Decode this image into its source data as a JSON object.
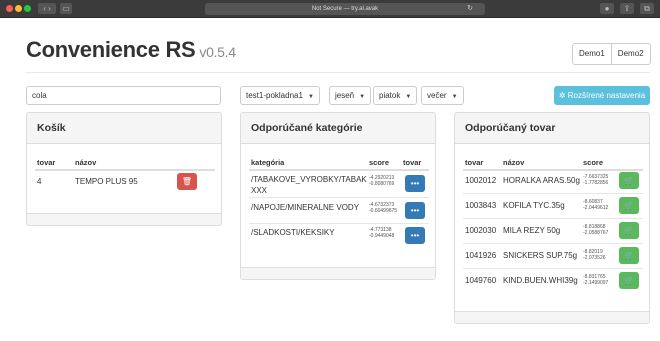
{
  "browser": {
    "url_text": "Not Secure — try.al.avak"
  },
  "app": {
    "title": "Convenience RS",
    "version": "v0.5.4"
  },
  "demo_buttons": [
    "Demo1",
    "Demo2"
  ],
  "search": {
    "value": "cola"
  },
  "filters": [
    {
      "label": "test1-pokladna1"
    },
    {
      "label": "jeseň"
    },
    {
      "label": "piatok"
    },
    {
      "label": "večer"
    }
  ],
  "advanced_button": "Rozšírené nastavenia",
  "kosik": {
    "title": "Košík",
    "columns": [
      "tovar",
      "názov"
    ],
    "rows": [
      {
        "tovar": "4",
        "nazov": "TEMPO PLUS 95"
      }
    ]
  },
  "categories": {
    "title": "Odporúčané kategórie",
    "columns": [
      "kategória",
      "score",
      "tovar"
    ],
    "rows": [
      {
        "name_line1": "/TABAKOVE_VYROBKY/TABAK",
        "name_line2": "XXX",
        "score1": "-4.2920213",
        "score2": "-0.8080769",
        "button": "•••"
      },
      {
        "name_line1": "/NAPOJE/MINERALNE VODY",
        "name_line2": "",
        "score1": "-4.6732373",
        "score2": "-0.60499675",
        "button": "•••"
      },
      {
        "name_line1": "/SLADKOSTI/KEKSIKY",
        "name_line2": "",
        "score1": "-4.773138",
        "score2": "-0.9449048",
        "button": "•••"
      }
    ]
  },
  "products": {
    "title": "Odporúčaný tovar",
    "columns": [
      "tovar",
      "názov",
      "score"
    ],
    "rows": [
      {
        "tovar": "1002012",
        "nazov": "HORALKA ARAS.50g",
        "score1": "-7.6637325",
        "score2": "-1.7782856"
      },
      {
        "tovar": "1003843",
        "nazov": "KOFILA TYC.35g",
        "score1": "-8.60837",
        "score2": "-2.0449612"
      },
      {
        "tovar": "1002030",
        "nazov": "MILA REZY 50g",
        "score1": "-8.818868",
        "score2": "-2.0588767"
      },
      {
        "tovar": "1041926",
        "nazov": "SNICKERS SUP.75g",
        "score1": "-8.82019",
        "score2": "-2.073526"
      },
      {
        "tovar": "1049760",
        "nazov": "KIND.BUEN.WHI39g",
        "score1": "-8.831765",
        "score2": "-2.1499097"
      }
    ]
  },
  "colors": {
    "info": "#5bc0de",
    "primary": "#337ab7",
    "success": "#5cb85c",
    "danger": "#d9534f"
  },
  "icons": {
    "trash": "trash-icon",
    "cart": "cart-icon",
    "cog": "cog-icon",
    "ellipsis": "ellipsis-icon"
  }
}
